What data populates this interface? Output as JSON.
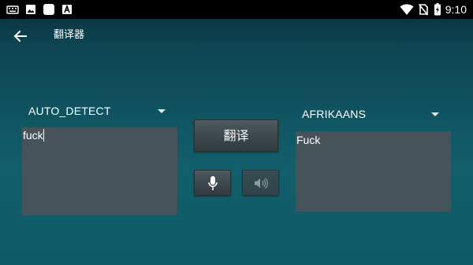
{
  "status_bar": {
    "time": "9:10",
    "left_icons": [
      "keyboard-icon",
      "image-icon",
      "square-app-icon",
      "letter-a-app-icon"
    ],
    "right_icons": [
      "wifi-icon",
      "no-sim-icon",
      "battery-charging-icon"
    ]
  },
  "app_bar": {
    "title": "翻译器",
    "back_icon": "arrow-left-icon"
  },
  "source": {
    "language": "AUTO_DETECT",
    "text": "fuck"
  },
  "target": {
    "language": "AFRIKAANS",
    "text": "Fuck"
  },
  "actions": {
    "translate_label": "翻译",
    "mic_icon": "microphone-icon",
    "speaker_icon": "speaker-icon"
  },
  "colors": {
    "background_top": "#0a2e3a",
    "background_bottom": "#0e5a67",
    "text_box": "#46545a",
    "status_bar": "#000000"
  }
}
